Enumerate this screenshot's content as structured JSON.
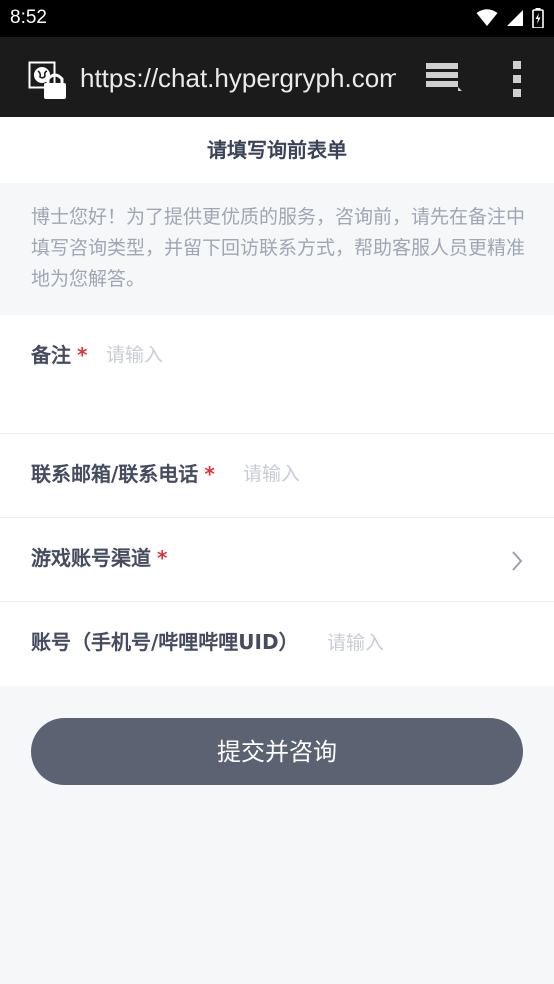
{
  "status_bar": {
    "time": "8:52"
  },
  "browser": {
    "url": "https://chat.hypergryph.com",
    "icons": [
      "globe-lock-icon",
      "tabs-icon",
      "more-vertical-icon"
    ]
  },
  "page": {
    "title": "请填写询前表单",
    "notice": "博士您好！为了提供更优质的服务，咨询前，请先在备注中填写咨询类型，并留下回访联系方式，帮助客服人员更精准地为您解答。"
  },
  "form": {
    "remark": {
      "label": "备注",
      "required_mark": "*",
      "placeholder": "请输入"
    },
    "contact": {
      "label": "联系邮箱/联系电话",
      "required_mark": "*",
      "placeholder": "请输入"
    },
    "channel": {
      "label": "游戏账号渠道",
      "required_mark": "*"
    },
    "account": {
      "label": "账号（手机号/哔哩哔哩UID）",
      "placeholder": "请输入"
    }
  },
  "submit_label": "提交并咨询",
  "colors": {
    "accent_required": "#e0323b",
    "button_bg": "#5b6272",
    "page_bg": "#f6f7f9"
  }
}
